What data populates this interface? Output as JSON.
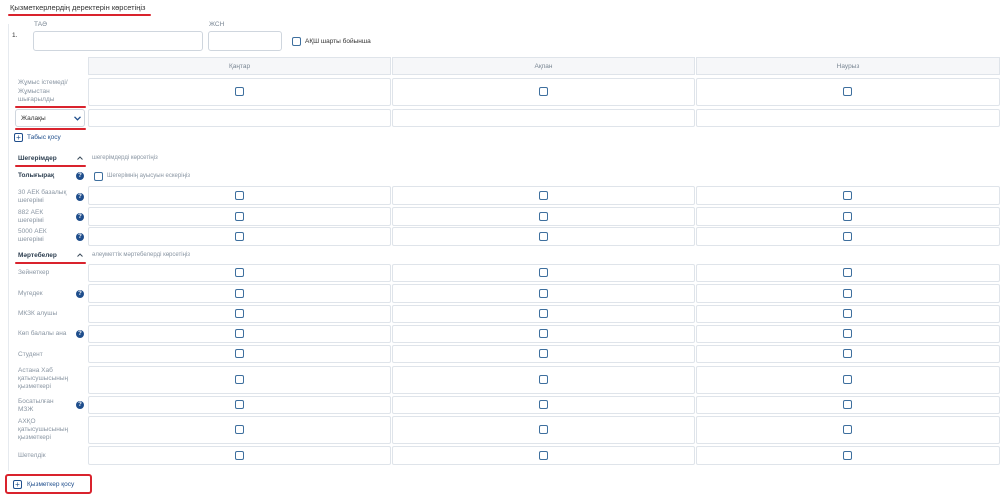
{
  "page": {
    "title": "Қызметкерлердің деректерін көрсетіңіз"
  },
  "employee": {
    "index": "1.",
    "name_label": "ТАӘ",
    "iin_label": "ЖСН",
    "usa_label": "АҚШ шарты бойынша"
  },
  "months": [
    "Қаңтар",
    "Ақпан",
    "Наурыз"
  ],
  "row_fired": "Жұмыс істемеді/ Жұмыстан шығарылды",
  "income_select": {
    "value": "Жалақы"
  },
  "add_income": "Табыс қосу",
  "deductions": {
    "label": "Шегерімдер",
    "hint": "шегерімдерді көрсетіңіз",
    "full_label": "Толығырақ",
    "transfer_label": "Шегерімнің ауысуын ескеріңіз",
    "rows": [
      "30 АЕК базалық шегерімі",
      "882 АЕК шегерімі",
      "5000 АЕК шегерімі"
    ]
  },
  "statuses": {
    "label": "Мәртебелер",
    "hint": "әлеуметтік мәртебелерді көрсетіңіз",
    "rows": [
      "Зейнеткер",
      "Мүгедек",
      "МКЗК алушы",
      "Көп балалы ана",
      "Студент",
      "Астана Хаб қатысушысының қызметкері",
      "Босатылған МЗЖ",
      "АХҚО қатысушысының қызметкері",
      "Шетелдік"
    ]
  },
  "add_employee": "Қызметкер қосу"
}
